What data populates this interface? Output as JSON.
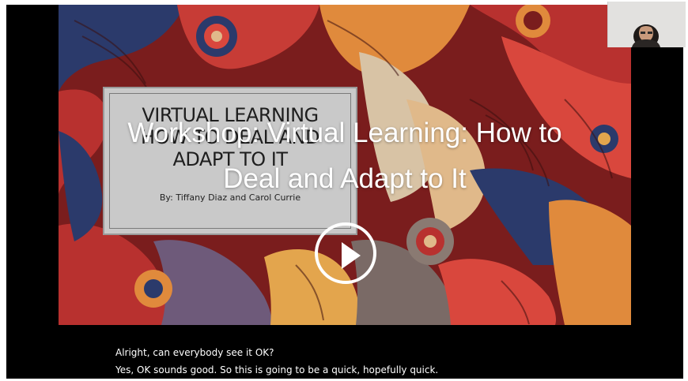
{
  "video": {
    "overlay_title": "Workshop: Virtual Learning: How to\nDeal and Adapt to It",
    "slide": {
      "title": "VIRTUAL LEARNING\nHOW TO DEAL AND\nADAPT TO IT",
      "byline": "By: Tiffany Diaz and Carol Currie"
    },
    "captions": [
      "Alright, can everybody see it OK?",
      "Yes, OK sounds good. So this is going to be a quick, hopefully quick."
    ],
    "controls": {
      "play_icon": "play-icon"
    }
  },
  "colors": {
    "background": "#000000",
    "slide_box": "#c9c9c9",
    "overlay_text": "#ffffff",
    "pattern_primary": "#b8312f",
    "pattern_secondary": "#2b3a6b",
    "pattern_accent": "#e08a3c"
  }
}
